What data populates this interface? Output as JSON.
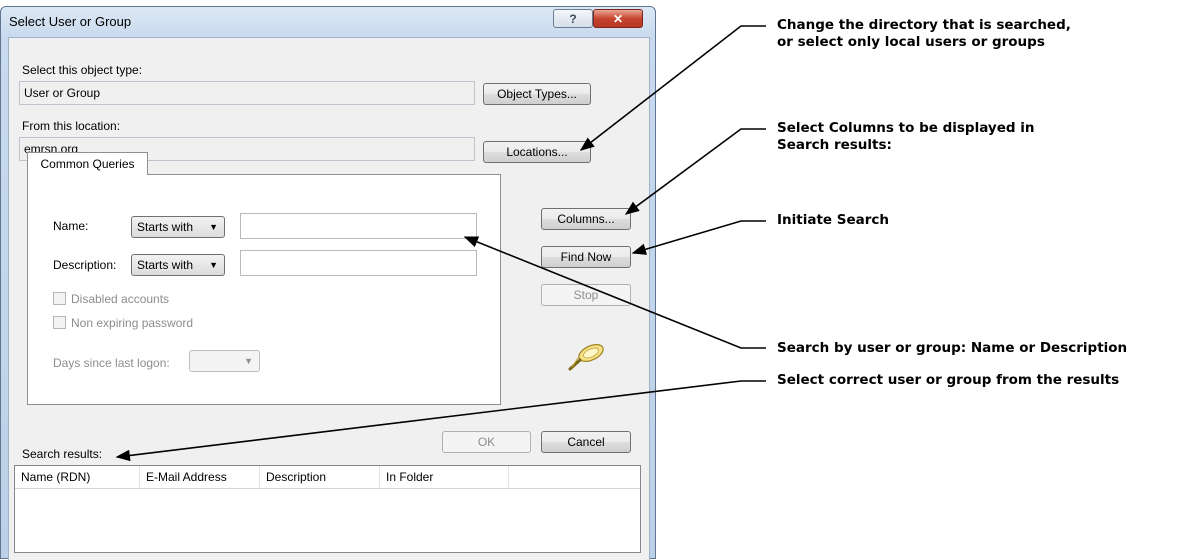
{
  "window": {
    "title": "Select User or Group",
    "help_glyph": "?",
    "close_glyph": "✕"
  },
  "object_type": {
    "label": "Select this object type:",
    "value": "User or Group",
    "button": "Object Types..."
  },
  "location": {
    "label": "From this location:",
    "value": "emrsn.org",
    "button": "Locations..."
  },
  "queries": {
    "tab_label": "Common Queries",
    "name_label": "Name:",
    "name_mode": "Starts with",
    "name_value": "",
    "description_label": "Description:",
    "description_mode": "Starts with",
    "description_value": "",
    "disabled_accounts": "Disabled accounts",
    "non_expiring_password": "Non expiring password",
    "days_since_logon_label": "Days since last logon:",
    "days_since_logon_value": ""
  },
  "side_buttons": {
    "columns": "Columns...",
    "find_now": "Find Now",
    "stop": "Stop"
  },
  "footer": {
    "ok": "OK",
    "cancel": "Cancel",
    "results_label": "Search results:"
  },
  "results_columns": [
    "Name (RDN)",
    "E-Mail Address",
    "Description",
    "In Folder"
  ],
  "annotations": {
    "directory_line1": "Change the directory that is searched,",
    "directory_line2": "or select only local users or groups",
    "columns_line1": "Select Columns to be displayed in",
    "columns_line2": "Search results:",
    "initiate": "Initiate Search",
    "search_by": "Search by user or group: Name or Description",
    "select_correct": "Select correct user or group from the results"
  },
  "icons": {
    "search": "magnifier-icon",
    "dropdown": "▼"
  }
}
